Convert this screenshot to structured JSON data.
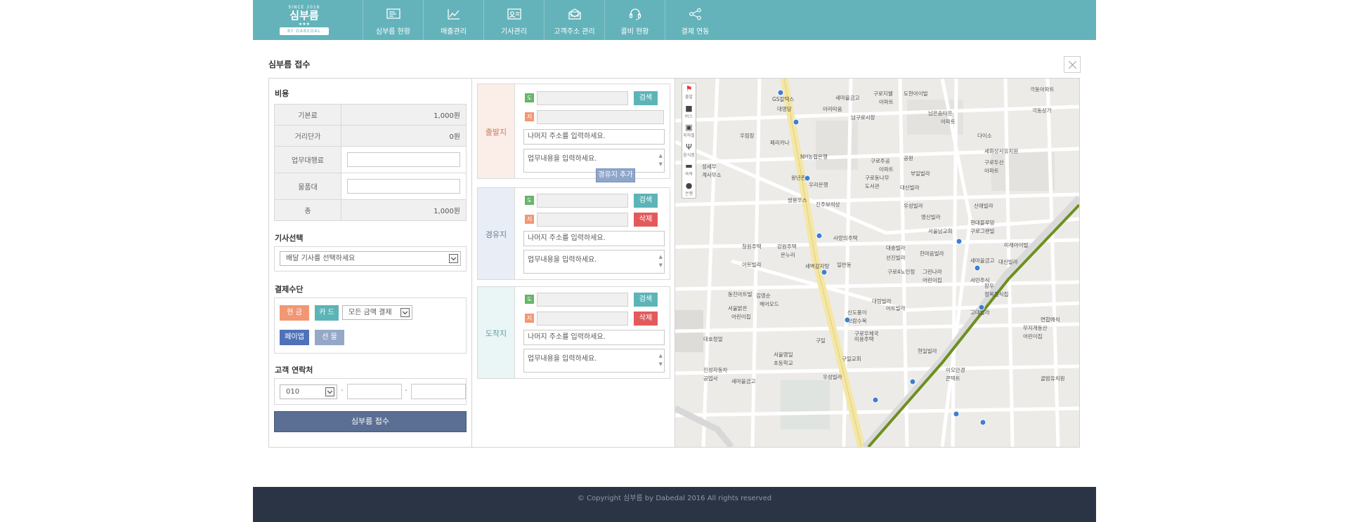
{
  "header": {
    "logo_since": "SINCE 2016",
    "logo_name": "심부름",
    "logo_stars": "★★★",
    "logo_ribbon": "BY DABEDAL",
    "nav": [
      {
        "label": "심부름 현황",
        "icon": "status-list-icon"
      },
      {
        "label": "매출관리",
        "icon": "line-chart-icon"
      },
      {
        "label": "기사관리",
        "icon": "id-card-icon"
      },
      {
        "label": "고객주소 관리",
        "icon": "address-book-icon"
      },
      {
        "label": "콜비 현황",
        "icon": "headset-icon"
      },
      {
        "label": "결제 연동",
        "icon": "share-icon"
      }
    ]
  },
  "page": {
    "title": "심부름 접수"
  },
  "fees": {
    "title": "비용",
    "base_label": "기본료",
    "base_value": "1,000원",
    "distance_label": "거리단가",
    "distance_value": "0원",
    "agency_label": "업무대행료",
    "goods_label": "물품대",
    "total_label": "총",
    "total_value": "1,000원"
  },
  "driver": {
    "title": "기사선택",
    "placeholder": "배달 기사를 선택하세요"
  },
  "payment": {
    "title": "결제수단",
    "cash": "현 금",
    "card": "카 드",
    "card_option": "모든 금액 결제",
    "payapp": "페이앱",
    "gift": "선 물"
  },
  "contact": {
    "title": "고객 연락처",
    "prefix": "010"
  },
  "submit_label": "심부름 접수",
  "origin": {
    "label": "출발지",
    "tag_do": "도",
    "tag_ji": "지",
    "search": "검색",
    "detail_placeholder": "나머지 주소를 입력하세요.",
    "task_placeholder": "업무내용을 입력하세요."
  },
  "add_waypoint": "경유지 추가",
  "waypoint": {
    "label": "경유지",
    "tag_do": "도",
    "tag_ji": "지",
    "search": "검색",
    "delete": "삭제",
    "detail_placeholder": "나머지 주소를 입력하세요.",
    "task_placeholder": "업무내용을 입력하세요."
  },
  "destination": {
    "label": "도착지",
    "tag_do": "도",
    "tag_ji": "지",
    "search": "검색",
    "delete": "삭제",
    "detail_placeholder": "나머지 주소를 입력하세요.",
    "task_placeholder": "업무내용을 입력하세요."
  },
  "map": {
    "toolbar": [
      {
        "label": "출발",
        "icon": "start-flag-icon"
      },
      {
        "label": "버스",
        "icon": "bus-icon"
      },
      {
        "label": "지하철",
        "icon": "subway-icon"
      },
      {
        "label": "음식점",
        "icon": "restaurant-icon"
      },
      {
        "label": "숙박",
        "icon": "bed-icon"
      },
      {
        "label": "은행",
        "icon": "bank-icon"
      }
    ],
    "places": [
      "GS칼텍스",
      "대영당",
      "아리따움",
      "새마을금고",
      "구로지웰",
      "아파트",
      "도현아이빌",
      "극동아파트",
      "극동상가",
      "남구로시장",
      "남은솜타운",
      "아파트",
      "우림장",
      "페리카나",
      "NH농협은행",
      "구로주공",
      "아파트",
      "구로동나무",
      "도서관",
      "공원",
      "부일빌라",
      "다이소",
      "세화상사유치원",
      "구로두산",
      "아파트",
      "성세무",
      "계사무소",
      "왕년촌",
      "우리은행",
      "대신빌라",
      "우성빌라",
      "신애빌라",
      "쌍용우스",
      "진주보석상",
      "영신빌라",
      "현대블루밍",
      "구로그랜빌",
      "서울남교회",
      "미래아이빌",
      "청원주택",
      "강원주택",
      "온누리",
      "사랑의주택",
      "한마음빌라",
      "선진빌라",
      "아트빌라",
      "대송빌라",
      "새벽감자탕",
      "일반동",
      "구로4노인정",
      "그린나라",
      "어린이집",
      "새마을금고",
      "대신빌라",
      "서민주식",
      "장우",
      "정목점식집",
      "동진아트빌",
      "김영순",
      "헤어모드",
      "대림빌라",
      "서울밝은",
      "어린이집",
      "아트빌라",
      "신도풍이",
      "보람수목",
      "구로우체국",
      "고대빌라",
      "연합예식",
      "대호정밀",
      "구일",
      "미용주택",
      "무지개동산",
      "어린이집",
      "서울영일",
      "초등학교",
      "구일교회",
      "현일빌라",
      "진성자동차",
      "공업사",
      "새마을금고",
      "우성빌라",
      "이오안경",
      "콘텍트",
      "골밤유치원"
    ]
  },
  "footer": "© Copyright 심부름 by Dabedal 2016 All rights reserved"
}
